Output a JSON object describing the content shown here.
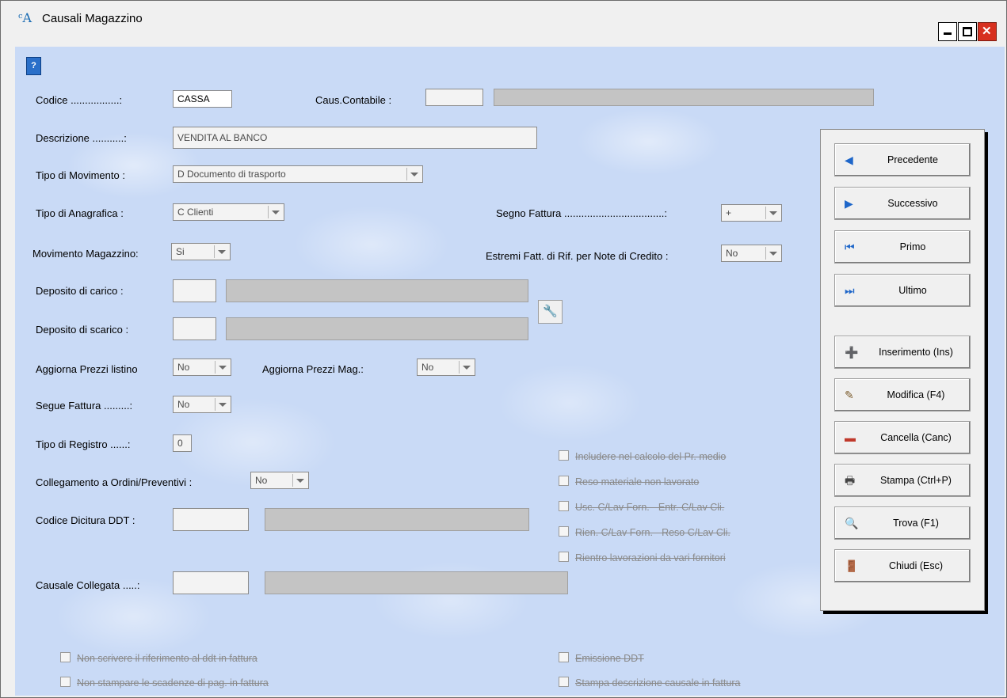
{
  "window": {
    "title": "Causali Magazzino",
    "icon": "app-icon"
  },
  "form": {
    "codice_label": "Codice .................:",
    "codice_value": "CASSA",
    "caus_contabile_label": "Caus.Contabile :",
    "caus_contabile_value": "",
    "caus_contabile_desc": "",
    "descrizione_label": "Descrizione ...........:",
    "descrizione_value": "VENDITA AL BANCO",
    "tipo_movimento_label": "Tipo di Movimento :",
    "tipo_movimento_value": "D  Documento di trasporto",
    "tipo_anagrafica_label": "Tipo di Anagrafica :",
    "tipo_anagrafica_value": "C  Clienti",
    "segno_fattura_label": "Segno Fattura ...................................:",
    "segno_fattura_value": "+",
    "movimento_magazzino_label": "Movimento Magazzino:",
    "movimento_magazzino_value": "Si",
    "estremi_label": "Estremi Fatt. di Rif. per Note di Credito :",
    "estremi_value": "No",
    "deposito_carico_label": "Deposito di carico :",
    "deposito_scarico_label": "Deposito di scarico :",
    "aggiorna_listino_label": "Aggiorna Prezzi listino",
    "aggiorna_listino_value": "No",
    "aggiorna_mag_label": "Aggiorna Prezzi Mag.:",
    "aggiorna_mag_value": "No",
    "segue_fattura_label": "Segue Fattura .........:",
    "segue_fattura_value": "No",
    "tipo_registro_label": "Tipo di Registro ......:",
    "tipo_registro_value": "0",
    "collegamento_label": "Collegamento a Ordini/Preventivi :",
    "collegamento_value": "No",
    "codice_dicitura_label": "Codice Dicitura DDT :",
    "causale_collegata_label": "Causale Collegata .....:"
  },
  "checkboxes_right": [
    "Includere nel calcolo del Pr. medio",
    "Reso materiale non lavorato",
    "Usc. C/Lav Forn. - Entr. C/Lav Cli.",
    "Rien. C/Lav Forn. - Reso C/Lav Cli.",
    "Rientro lavorazioni da vari fornitori"
  ],
  "checkboxes_bottom": {
    "non_scrivere": "Non scrivere il riferimento al ddt in fattura",
    "non_stampare": "Non stampare le scadenze di pag. in fattura",
    "emissione_ddt": "Emissione DDT",
    "stampa_descrizione": "Stampa descrizione causale in fattura"
  },
  "panel": {
    "precedente": "Precedente",
    "successivo": "Successivo",
    "primo": "Primo",
    "ultimo": "Ultimo",
    "inserimento": "Inserimento (Ins)",
    "modifica": "Modifica (F4)",
    "cancella": "Cancella (Canc)",
    "stampa": "Stampa (Ctrl+P)",
    "trova": "Trova (F1)",
    "chiudi": "Chiudi (Esc)"
  },
  "colors": {
    "background": "#c9daf6",
    "close_button": "#d7301f"
  }
}
